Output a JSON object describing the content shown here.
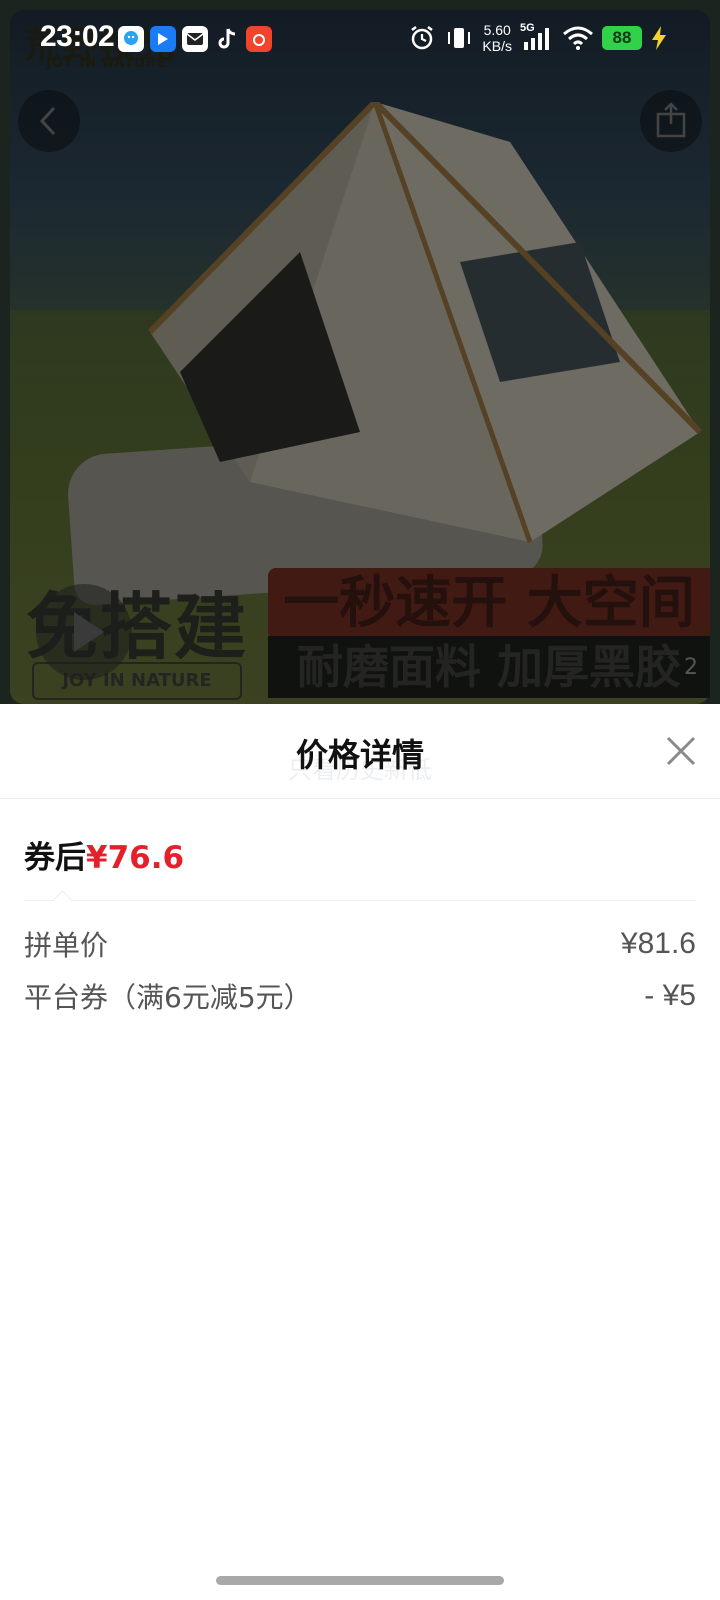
{
  "status_bar": {
    "time": "23:02",
    "net_speed_value": "5.60",
    "net_speed_unit": "KB/s",
    "network": "5G",
    "battery": "88",
    "app_icons": [
      "qq-icon",
      "baidu-netdisk-icon",
      "email-icon",
      "tiktok-icon",
      "weibo-icon"
    ]
  },
  "hero": {
    "brand_top": "荒野按光",
    "brand_top_sub": "JOY IN NATURE",
    "banner_left": "免搭建",
    "banner_left_sub": "JOY IN NATURE",
    "banner_red": "一秒速开 大空间",
    "banner_dark": "耐磨面料 加厚黑胶",
    "page_indicator": "2"
  },
  "sheet": {
    "ghost_text": "只看历史新低",
    "title": "价格详情",
    "summary_label": "券后",
    "summary_price": "¥76.6",
    "rows": [
      {
        "label": "拼单价",
        "value": "¥81.6"
      },
      {
        "label": "平台券（满6元减5元）",
        "value": "- ¥5"
      }
    ]
  },
  "colors": {
    "price_red": "#e4212b",
    "battery_green": "#31d14a"
  }
}
